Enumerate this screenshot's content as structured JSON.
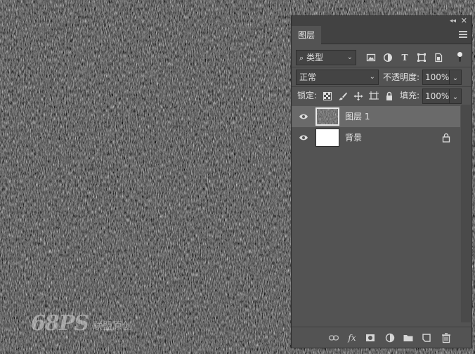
{
  "colors": {
    "canvas_dark": "#2b2b2b",
    "panel_bg": "#535353",
    "panel_header": "#424242",
    "selected_row": "#6a6a6a"
  },
  "watermark": {
    "logo": "68PS",
    "text": "联盟原创"
  },
  "panel": {
    "collapse_glyph": "◂◂",
    "close_glyph": "✕",
    "tab_label": "图层",
    "menu_icon": "panel-menu-icon"
  },
  "filter": {
    "kind_label": "类型",
    "icons": [
      "image-filter-icon",
      "adjustment-filter-icon",
      "type-filter-icon",
      "shape-filter-icon",
      "smart-object-filter-icon"
    ],
    "filter_toggle": "on"
  },
  "blend": {
    "mode": "正常",
    "opacity_label": "不透明度:",
    "opacity_value": "100%"
  },
  "lock": {
    "label": "锁定:",
    "icons": [
      "lock-transparent-icon",
      "lock-pixels-icon",
      "lock-position-icon",
      "lock-artboard-icon",
      "lock-all-icon"
    ],
    "fill_label": "填充:",
    "fill_value": "100%"
  },
  "layers": [
    {
      "name": "图层 1",
      "selected": true,
      "visible": true,
      "thumbnail": "noise-texture"
    },
    {
      "name": "背景",
      "selected": false,
      "visible": true,
      "thumbnail": "white",
      "locked": true
    }
  ],
  "footer": {
    "icons": [
      "link-layers-icon",
      "fx-icon",
      "add-mask-icon",
      "adjustment-layer-icon",
      "new-group-icon",
      "new-layer-icon",
      "delete-layer-icon"
    ],
    "fx_label": "fx"
  }
}
